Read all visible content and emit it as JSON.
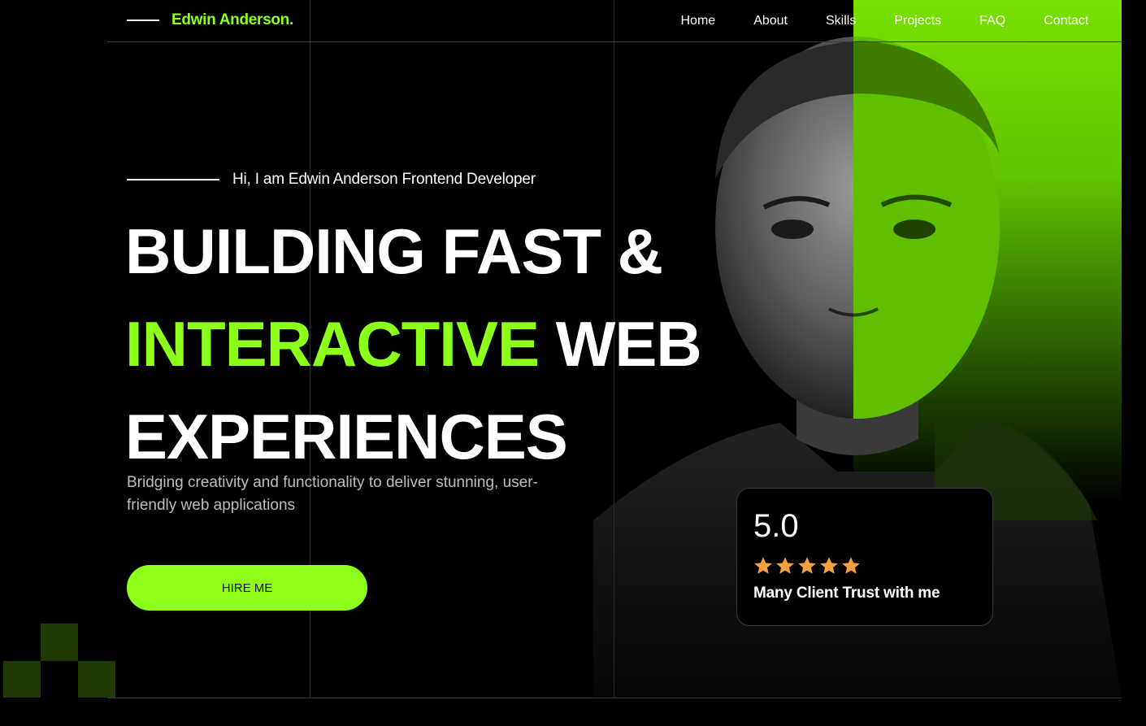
{
  "brand": {
    "name": "Edwin Anderson."
  },
  "nav": {
    "items": [
      "Home",
      "About",
      "Skills",
      "Projects",
      "FAQ",
      "Contact"
    ]
  },
  "hero": {
    "intro": "Hi, I am Edwin Anderson Frontend Developer",
    "headline": {
      "line1": "BUILDING FAST &",
      "line2_accent": "INTERACTIVE",
      "line2_rest": " WEB",
      "line3": "EXPERIENCES"
    },
    "subtext": "Bridging creativity and functionality to deliver stunning, user-friendly web applications",
    "cta_label": "HIRE ME"
  },
  "rating": {
    "value": "5.0",
    "stars": 5,
    "caption": "Many Client Trust with me"
  },
  "colors": {
    "accent": "#8cff1a",
    "background": "#000000",
    "star": "#f5a142",
    "pixel": "#1e3a00"
  }
}
